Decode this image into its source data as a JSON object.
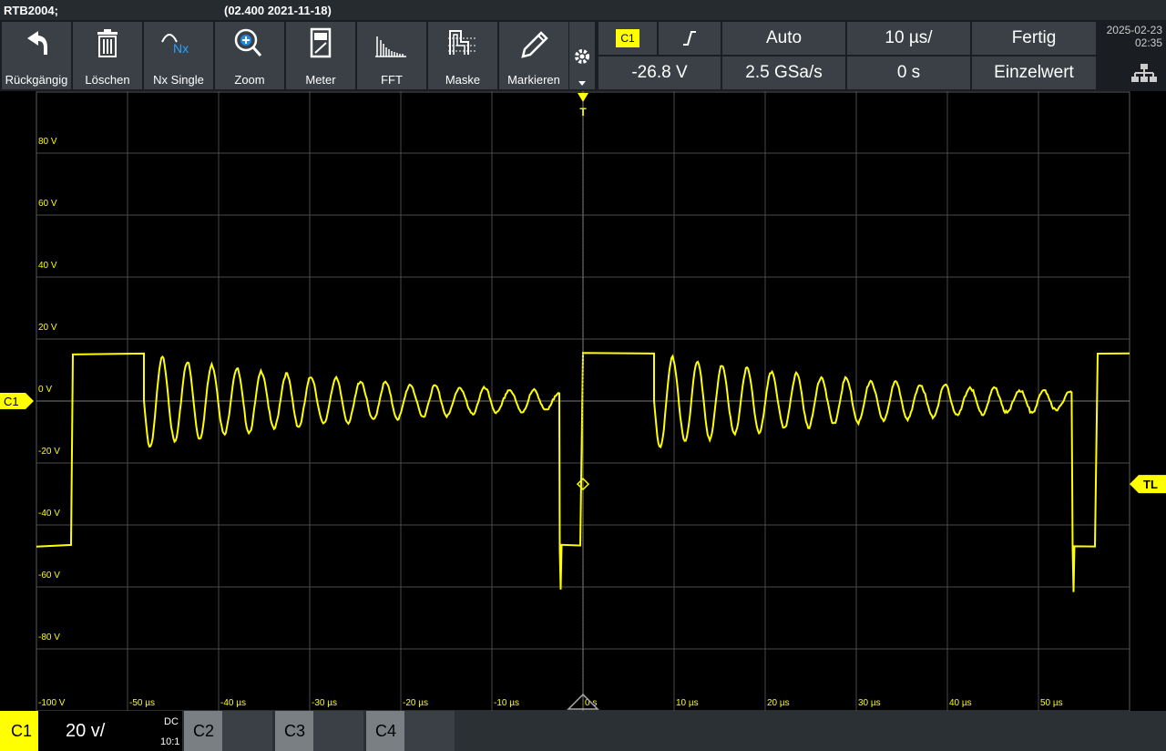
{
  "titlebar": {
    "device": "RTB2004;",
    "firmware": "(02.400 2021-11-18)"
  },
  "toolbar": {
    "buttons": [
      {
        "label": "Rückgängig",
        "icon": "undo-icon"
      },
      {
        "label": "Löschen",
        "icon": "trash-icon"
      },
      {
        "label": "Nx Single",
        "icon": "nx-single-icon"
      },
      {
        "label": "Zoom",
        "icon": "zoom-icon"
      },
      {
        "label": "Meter",
        "icon": "meter-icon"
      },
      {
        "label": "FFT",
        "icon": "fft-icon"
      },
      {
        "label": "Maske",
        "icon": "mask-icon"
      },
      {
        "label": "Markieren",
        "icon": "pen-icon"
      }
    ],
    "settings_icon": "gear-icon"
  },
  "trigger": {
    "source": "C1",
    "slope_icon": "rising-edge-icon",
    "level": "-26.8 V",
    "mode": "Auto",
    "sample_rate": "2.5 GSa/s",
    "timebase": "10 µs/",
    "position": "0 s",
    "status": "Fertig",
    "acq_mode": "Einzelwert"
  },
  "datetime": {
    "date": "2025-02-23",
    "time": "02:35"
  },
  "network_icon": "network-icon",
  "chart_data": {
    "type": "line",
    "title": "",
    "xlabel": "",
    "ylabel": "",
    "x_unit": "µs",
    "y_unit": "V",
    "xlim": [
      -60,
      60
    ],
    "ylim": [
      -100,
      100
    ],
    "y_ticks": [
      "80 V",
      "60 V",
      "40 V",
      "20 V",
      "0 V",
      "-20 V",
      "-40 V",
      "-60 V",
      "-80 V",
      "-100 V"
    ],
    "x_ticks": [
      "-50 µs",
      "-40 µs",
      "-30 µs",
      "-20 µs",
      "-10 µs",
      "0 s",
      "10 µs",
      "20 µs",
      "30 µs",
      "40 µs",
      "50 µs"
    ],
    "series": [
      {
        "color": "#ffff00",
        "x": [
          -60,
          -56.2,
          -56,
          -48.2,
          -47.6,
          -46.6,
          -45.6,
          -43,
          -38,
          -33,
          -28,
          -23,
          -18,
          -13,
          -8.5,
          -3.2,
          -2.6,
          -2.4,
          -0.3,
          0,
          7.8,
          8.4,
          9.4,
          10.4,
          13,
          18,
          23,
          28,
          33,
          38,
          43,
          46.4,
          53.7,
          54.2,
          56.2,
          56.5,
          60
        ],
        "y": [
          -47,
          -47,
          15,
          15,
          -2,
          -15,
          5,
          -2,
          -3,
          1,
          -2,
          1,
          -1,
          0,
          -1,
          -1,
          -48,
          -47,
          -47,
          15,
          15,
          -2,
          -16,
          5,
          -2,
          -3,
          1,
          -2,
          1,
          -1,
          0,
          -1,
          -1,
          -47,
          -47,
          15,
          15
        ]
      }
    ],
    "markers": {
      "channel_label": "C1",
      "trigger_top": "T",
      "trigger_level": "TL"
    }
  },
  "channels": [
    {
      "name": "C1",
      "scale": "20 v/",
      "coupling": "DC",
      "probe": "10:1",
      "active": true
    },
    {
      "name": "C2",
      "active": false
    },
    {
      "name": "C3",
      "active": false
    },
    {
      "name": "C4",
      "active": false
    }
  ],
  "colors": {
    "trace": "#ffff00",
    "grid": "#4a4a4a",
    "toolbar": "#3a4046"
  }
}
